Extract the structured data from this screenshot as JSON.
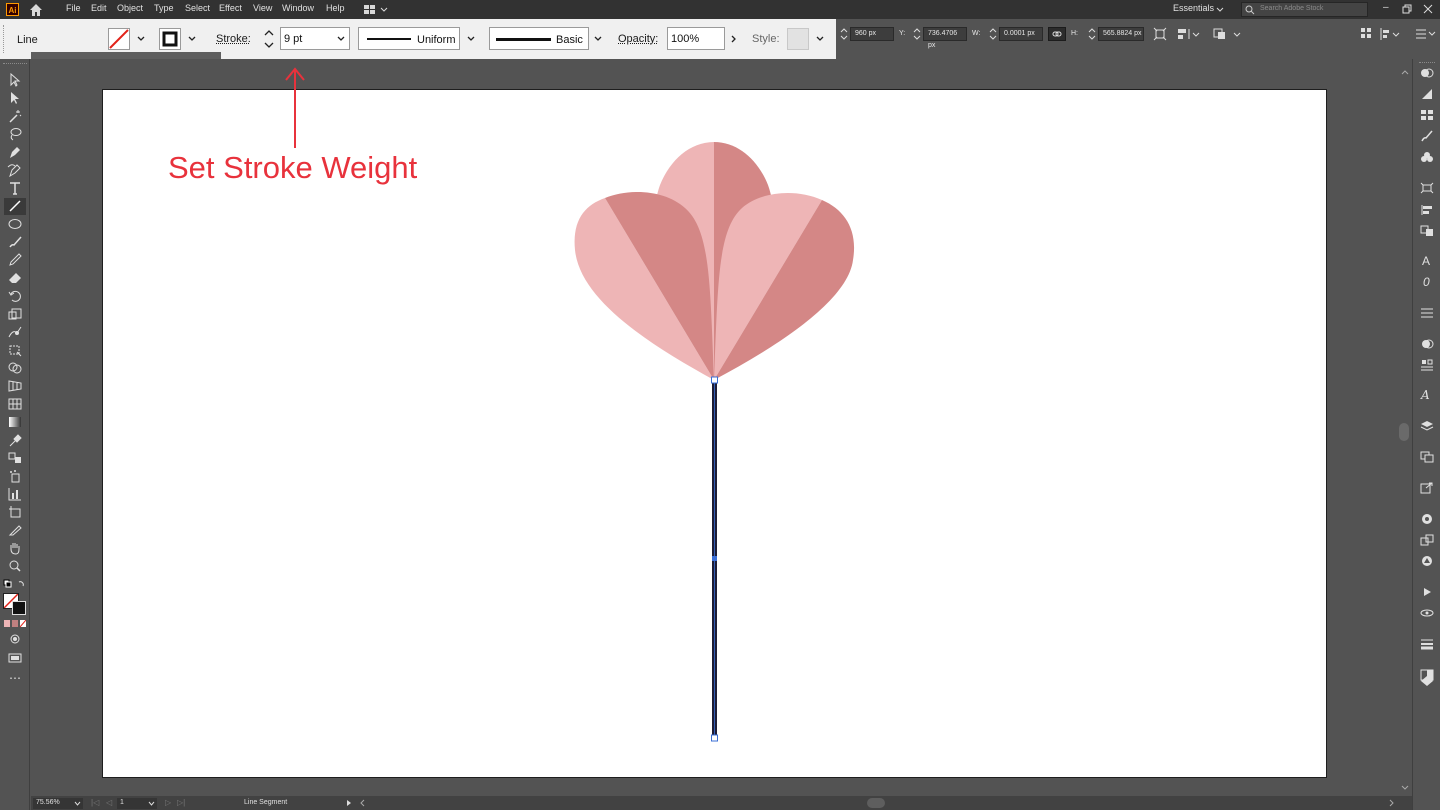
{
  "menubar": {
    "app_logo": "Ai",
    "items": [
      "File",
      "Edit",
      "Object",
      "Type",
      "Select",
      "Effect",
      "View",
      "Window",
      "Help"
    ],
    "workspace": "Essentials",
    "search_placeholder": "Search Adobe Stock"
  },
  "control": {
    "tool_name": "Line",
    "stroke_label": "Stroke:",
    "stroke_value": "9 pt",
    "profile_uniform": "Uniform",
    "brush_basic": "Basic",
    "opacity_label": "Opacity:",
    "opacity_value": "100%",
    "style_label": "Style:",
    "x_value": "960 px",
    "y_label": "Y:",
    "y_value": "736.4706 px",
    "w_label": "W:",
    "w_value": "0.0001 px",
    "h_label": "H:",
    "h_value": "565.8824 px"
  },
  "annotation": {
    "text": "Set Stroke Weight"
  },
  "status": {
    "zoom": "75.56%",
    "artboard": "1",
    "selection": "Line Segment"
  },
  "colors": {
    "petal_light": "#eeb5b6",
    "petal_dark": "#d48786",
    "stem": "#1d1d36",
    "annotation": "#e8323c",
    "selection": "#3b6fd6"
  },
  "icons": {
    "left_tools": [
      "selection-icon",
      "direct-selection-icon",
      "magic-wand-icon",
      "lasso-icon",
      "pen-icon",
      "curvature-icon",
      "type-icon",
      "line-segment-icon",
      "ellipse-icon",
      "paintbrush-icon",
      "pencil-icon",
      "eraser-icon",
      "rotate-icon",
      "scale-icon",
      "warp-icon",
      "free-transform-icon",
      "shape-builder-icon",
      "perspective-icon",
      "mesh-icon",
      "gradient-icon",
      "eyedropper-icon",
      "blend-icon",
      "symbol-sprayer-icon",
      "graph-icon",
      "artboard-icon",
      "slice-icon",
      "hand-icon",
      "zoom-icon"
    ],
    "right_panels": [
      "color-icon",
      "color-guide-icon",
      "swatches-icon",
      "brushes-icon",
      "symbols-icon",
      "transform-icon",
      "align-icon",
      "pathfinder-icon",
      "character-icon",
      "paragraph-icon",
      "opentype-icon",
      "appearance-icon",
      "graphic-styles-icon",
      "glyphs-icon",
      "layers-icon",
      "artboards-icon",
      "export-icon",
      "libraries-icon",
      "links-icon",
      "image-trace-icon",
      "actions-icon",
      "navigator-icon",
      "stroke-icon",
      "transparency-icon",
      "gradient-panel-icon"
    ]
  }
}
